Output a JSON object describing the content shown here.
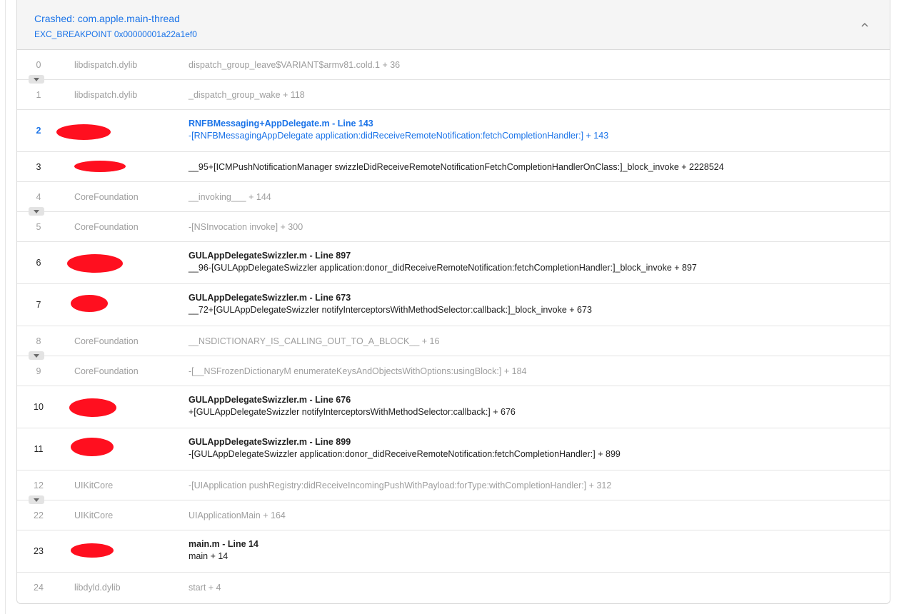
{
  "header": {
    "title": "Crashed: com.apple.main-thread",
    "subtitle": "EXC_BREAKPOINT 0x00000001a22a1ef0"
  },
  "frames": [
    {
      "num": "0",
      "lib": "libdispatch.dylib",
      "symbol": "dispatch_group_leave$VARIANT$armv81.cold.1 + 36"
    },
    {
      "num": "1",
      "lib": "libdispatch.dylib",
      "symbol": "_dispatch_group_wake + 118"
    },
    {
      "num": "2",
      "file": "RNFBMessaging+AppDelegate.m - Line 143",
      "symbol": "-[RNFBMessagingAppDelegate application:didReceiveRemoteNotification:fetchCompletionHandler:] + 143"
    },
    {
      "num": "3",
      "symbol": "__95+[ICMPushNotificationManager swizzleDidReceiveRemoteNotificationFetchCompletionHandlerOnClass:]_block_invoke + 2228524"
    },
    {
      "num": "4",
      "lib": "CoreFoundation",
      "symbol": "__invoking___ + 144"
    },
    {
      "num": "5",
      "lib": "CoreFoundation",
      "symbol": "-[NSInvocation invoke] + 300"
    },
    {
      "num": "6",
      "file": "GULAppDelegateSwizzler.m - Line 897",
      "symbol": "__96-[GULAppDelegateSwizzler application:donor_didReceiveRemoteNotification:fetchCompletionHandler:]_block_invoke + 897"
    },
    {
      "num": "7",
      "file": "GULAppDelegateSwizzler.m - Line 673",
      "symbol": "__72+[GULAppDelegateSwizzler notifyInterceptorsWithMethodSelector:callback:]_block_invoke + 673"
    },
    {
      "num": "8",
      "lib": "CoreFoundation",
      "symbol": "__NSDICTIONARY_IS_CALLING_OUT_TO_A_BLOCK__ + 16"
    },
    {
      "num": "9",
      "lib": "CoreFoundation",
      "symbol": "-[__NSFrozenDictionaryM enumerateKeysAndObjectsWithOptions:usingBlock:] + 184"
    },
    {
      "num": "10",
      "file": "GULAppDelegateSwizzler.m - Line 676",
      "symbol": "+[GULAppDelegateSwizzler notifyInterceptorsWithMethodSelector:callback:] + 676"
    },
    {
      "num": "11",
      "file": "GULAppDelegateSwizzler.m - Line 899",
      "symbol": "-[GULAppDelegateSwizzler application:donor_didReceiveRemoteNotification:fetchCompletionHandler:] + 899"
    },
    {
      "num": "12",
      "lib": "UIKitCore",
      "symbol": "-[UIApplication pushRegistry:didReceiveIncomingPushWithPayload:forType:withCompletionHandler:] + 312"
    },
    {
      "num": "22",
      "lib": "UIKitCore",
      "symbol": "UIApplicationMain + 164"
    },
    {
      "num": "23",
      "file": "main.m - Line 14",
      "symbol": "main + 14"
    },
    {
      "num": "24",
      "lib": "libdyld.dylib",
      "symbol": "start + 4"
    }
  ],
  "colors": {
    "accent": "#1a73e8",
    "redaction": "#ff0f1f",
    "muted": "#9e9e9e"
  },
  "icons": {
    "collapse": "chevron-up-icon",
    "expand": "chevron-down-icon",
    "selected": "triangle-right-icon"
  }
}
